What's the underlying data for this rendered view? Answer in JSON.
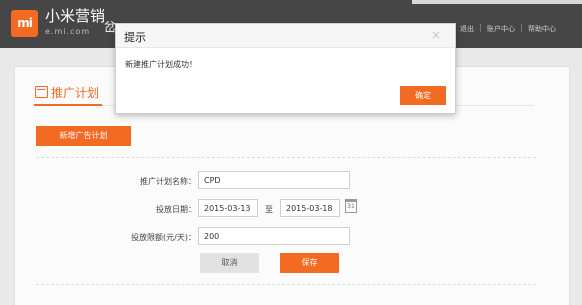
{
  "header": {
    "brand": "小米营销",
    "brand_sub": "e.mi.com",
    "nav_partial": "岔",
    "links": [
      "退出",
      "账户中心",
      "帮助中心"
    ],
    "logo_text": "mi"
  },
  "tab": {
    "label": "推广计划"
  },
  "toolbar": {
    "new_plan_label": "新增广告计划"
  },
  "form": {
    "plan_name_label": "推广计划名称：",
    "plan_name_value": "CPD",
    "date_label": "投放日期：",
    "date_start": "2015-03-13",
    "date_to": "至",
    "date_end": "2015-03-18",
    "calendar_day": "31",
    "budget_label": "投放限额(元/天)：",
    "budget_value": "200",
    "cancel_label": "取消",
    "save_label": "保存"
  },
  "dialog": {
    "title": "提示",
    "close": "×",
    "message": "新建推广计划成功！",
    "confirm_label": "确定"
  },
  "colors": {
    "accent": "#f36a22",
    "header_bg": "#464646"
  }
}
